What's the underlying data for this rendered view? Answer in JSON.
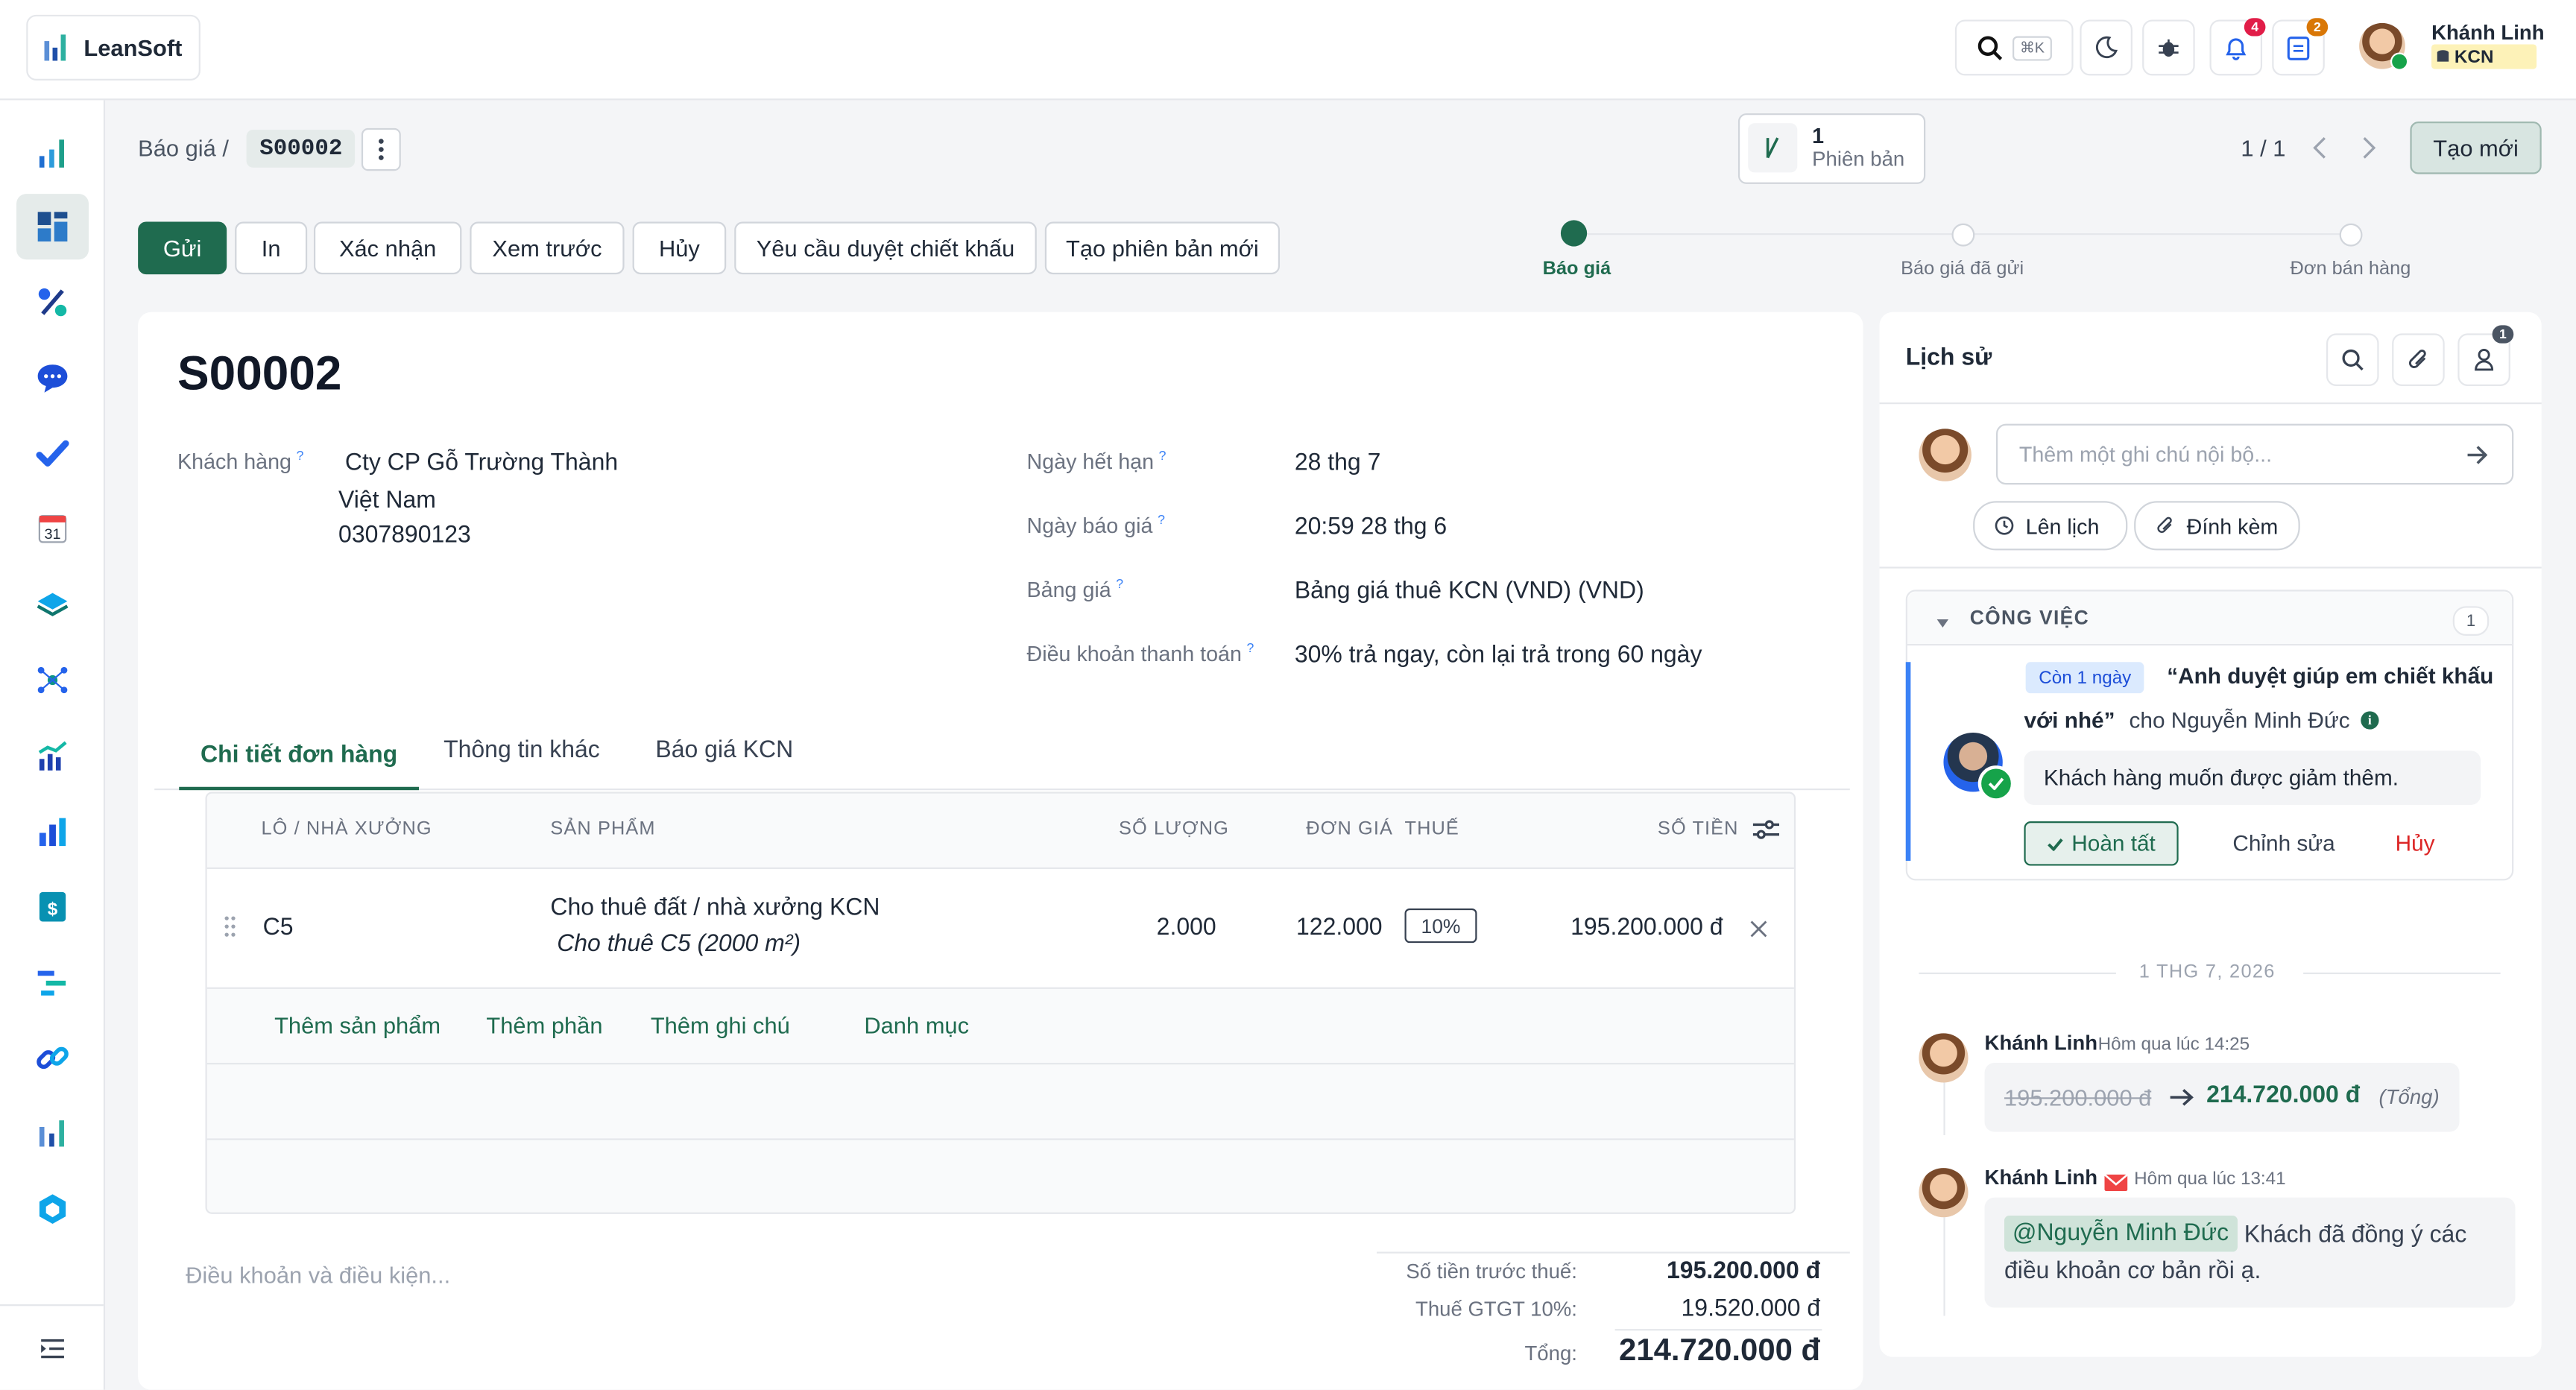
{
  "app": {
    "name": "LeanSoft"
  },
  "topbar": {
    "shortcut": "⌘K",
    "notif_count": "4",
    "task_count": "2",
    "user_name": "Khánh Linh",
    "user_company": "KCN"
  },
  "breadcrumb": {
    "parent": "Báo giá /",
    "current": "S00002"
  },
  "version": {
    "count": "1",
    "label": "Phiên bản"
  },
  "pager": {
    "text": "1 / 1"
  },
  "create_label": "Tạo mới",
  "actions": [
    "Gửi",
    "In",
    "Xác nhận",
    "Xem trước",
    "Hủy",
    "Yêu cầu duyệt chiết khấu",
    "Tạo phiên bản mới"
  ],
  "status_steps": [
    "Báo giá",
    "Báo giá đã gửi",
    "Đơn bán hàng"
  ],
  "record": {
    "title": "S00002",
    "customer_label": "Khách hàng",
    "customer_name": "Cty CP Gỗ Trường Thành",
    "customer_country": "Việt Nam",
    "customer_phone": "0307890123",
    "expiry_label": "Ngày hết hạn",
    "expiry": "28 thg 7",
    "quote_date_label": "Ngày báo giá",
    "quote_date": "20:59 28 thg 6",
    "pricelist_label": "Bảng giá",
    "pricelist": "Bảng giá thuê KCN (VND) (VND)",
    "terms_label": "Điều khoản thanh toán",
    "terms": "30% trả ngay, còn lại trả trong 60 ngày"
  },
  "tabs": [
    "Chi tiết đơn hàng",
    "Thông tin khác",
    "Báo giá KCN"
  ],
  "table": {
    "headers": [
      "LÔ / NHÀ XƯỞNG",
      "SẢN PHẨM",
      "SỐ LƯỢNG",
      "ĐƠN GIÁ",
      "THUẾ",
      "SỐ TIỀN"
    ],
    "row": {
      "lot": "C5",
      "product": "Cho thuê đất / nhà xưởng KCN",
      "desc": "Cho thuê C5 (2000 m²)",
      "qty": "2.000",
      "price": "122.000",
      "tax": "10%",
      "amount": "195.200.000 đ"
    },
    "add_links": [
      "Thêm sản phẩm",
      "Thêm phần",
      "Thêm ghi chú",
      "Danh mục"
    ]
  },
  "terms_placeholder": "Điều khoản và điều kiện...",
  "totals": {
    "untaxed_label": "Số tiền trước thuế:",
    "untaxed": "195.200.000 đ",
    "vat_label": "Thuế GTGT 10%:",
    "vat": "19.520.000 đ",
    "total_label": "Tổng:",
    "total": "214.720.000 đ"
  },
  "chatter": {
    "title": "Lịch sử",
    "followers": "1",
    "placeholder": "Thêm một ghi chú nội bộ...",
    "schedule": "Lên lịch",
    "attach": "Đính kèm",
    "activities_title": "CÔNG VIỆC",
    "activities_count": "1",
    "activity": {
      "due": "Còn 1 ngày",
      "summary_1": "“Anh duyệt giúp em chiết khấu",
      "summary_2": "với nhé”",
      "for": "cho Nguyễn Minh Đức",
      "note": "Khách hàng muốn được giảm thêm.",
      "done": "Hoàn tất",
      "edit": "Chỉnh sửa",
      "cancel": "Hủy"
    },
    "date_sep": "1 THG 7, 2026",
    "msg1": {
      "author": "Khánh Linh",
      "time": "Hôm qua lúc 14:25",
      "old": "195.200.000 đ",
      "new": "214.720.000 đ",
      "field": "(Tổng)"
    },
    "msg2": {
      "author": "Khánh Linh",
      "time": "Hôm qua lúc 13:41",
      "mention": "@Nguyễn Minh Đức",
      "text_1": "Khách đã đồng ý các",
      "text_2": "điều khoản cơ bản rồi ạ."
    }
  }
}
